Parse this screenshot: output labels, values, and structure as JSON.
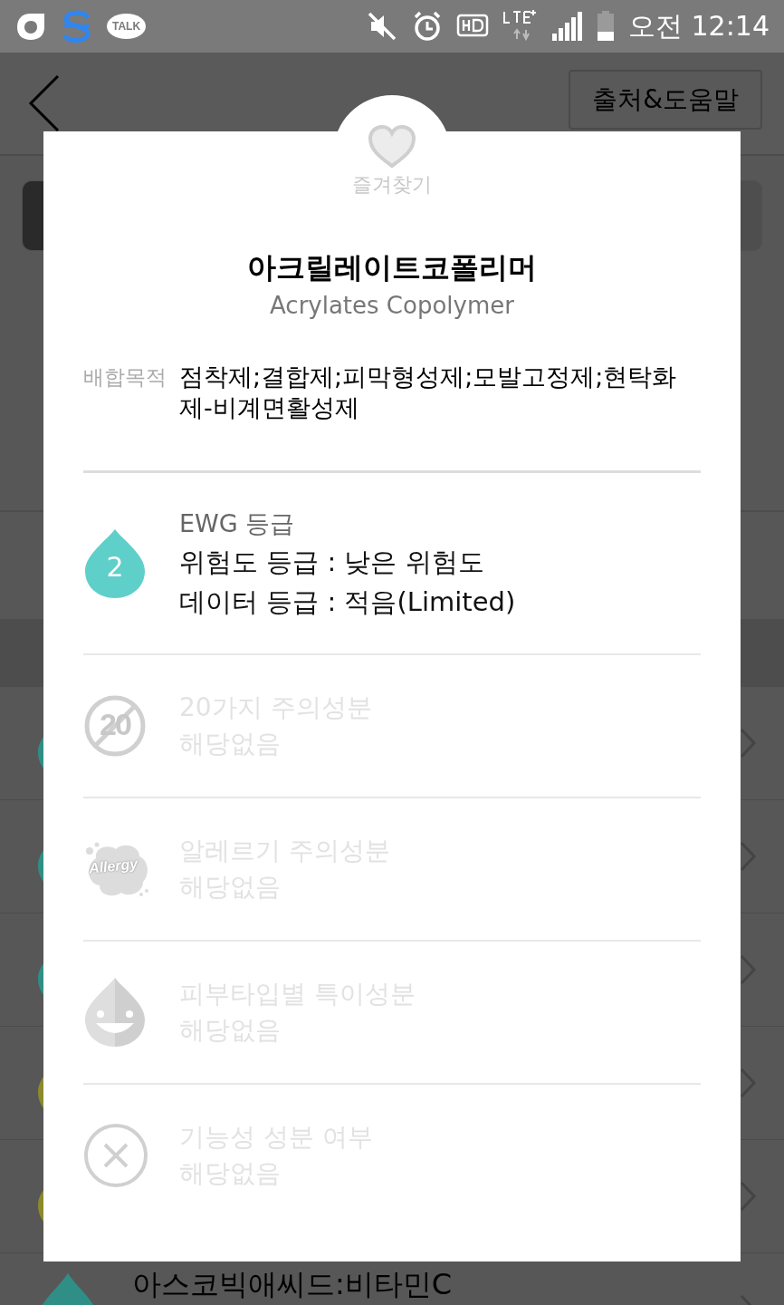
{
  "status_bar": {
    "app_icons": [
      {
        "kind": "ring"
      },
      {
        "kind": "s"
      },
      {
        "kind": "talk",
        "label": "TALK"
      }
    ],
    "time": "오전 12:14"
  },
  "app_bar": {
    "help_button": "출처&도움말"
  },
  "background_rows": [
    {
      "color": "#2f8f86"
    },
    {
      "color": "#2f8f86"
    },
    {
      "color": "#2f8f86"
    },
    {
      "color": "#8c8a2c"
    },
    {
      "color": "#8c8a2c"
    },
    {
      "color": "#2f8f86",
      "name": "아스코빅애씨드:비타민C"
    }
  ],
  "dialog": {
    "favorite_label": "즐겨찾기",
    "favorite": false,
    "name_ko": "아크릴레이트코폴리머",
    "name_en": "Acrylates Copolymer",
    "purpose_label": "배합목적",
    "purpose": "점착제;결합제;피막형성제;모발고정제;현탁화제-비계면활성제",
    "sections": [
      {
        "kind": "ewg",
        "badge": "2",
        "heading": "EWG 등급",
        "lines": [
          "위험도 등급 : 낮은 위험도",
          "데이터 등급 : 적음(Limited)"
        ]
      },
      {
        "kind": "twenty",
        "badge": "20",
        "heading": "20가지 주의성분",
        "lines": [
          "해당없음"
        ]
      },
      {
        "kind": "allergy",
        "badge": "Allergy",
        "heading": "알레르기 주의성분",
        "lines": [
          "해당없음"
        ]
      },
      {
        "kind": "skin",
        "heading": "피부타입별 특이성분",
        "lines": [
          "해당없음"
        ]
      },
      {
        "kind": "functional",
        "heading": "기능성 성분 여부",
        "lines": [
          "해당없음"
        ]
      }
    ]
  }
}
